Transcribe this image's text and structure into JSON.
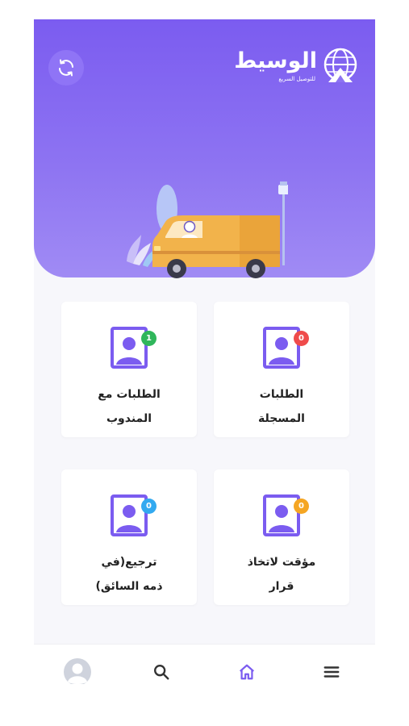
{
  "brand": {
    "name": "الوسيط",
    "tagline": "للتوصيل السريع"
  },
  "colors": {
    "primary": "#7b5cf0",
    "badge_red": "#ef4b4b",
    "badge_green": "#2fb65b",
    "badge_blue": "#32a9f0",
    "badge_orange": "#f5a623"
  },
  "cards": [
    {
      "id": "registered",
      "line1": "الطلبات",
      "line2": "المسجلة",
      "count": "0",
      "icon": "user-profile-icon"
    },
    {
      "id": "with-courier",
      "line1": "الطلبات مع",
      "line2": "المندوب",
      "count": "1",
      "icon": "user-profile-icon"
    },
    {
      "id": "pending-decision",
      "line1": "مؤقت لاتخاذ",
      "line2": "قرار",
      "count": "0",
      "icon": "user-profile-icon"
    },
    {
      "id": "returns",
      "line1": "ترجيع(في",
      "line2": "ذمه السائق)",
      "count": "0",
      "icon": "user-profile-icon"
    }
  ],
  "nav": [
    {
      "id": "profile",
      "icon": "avatar-icon"
    },
    {
      "id": "search",
      "icon": "search-icon"
    },
    {
      "id": "home",
      "icon": "home-icon",
      "active": true
    },
    {
      "id": "menu",
      "icon": "menu-icon"
    }
  ]
}
